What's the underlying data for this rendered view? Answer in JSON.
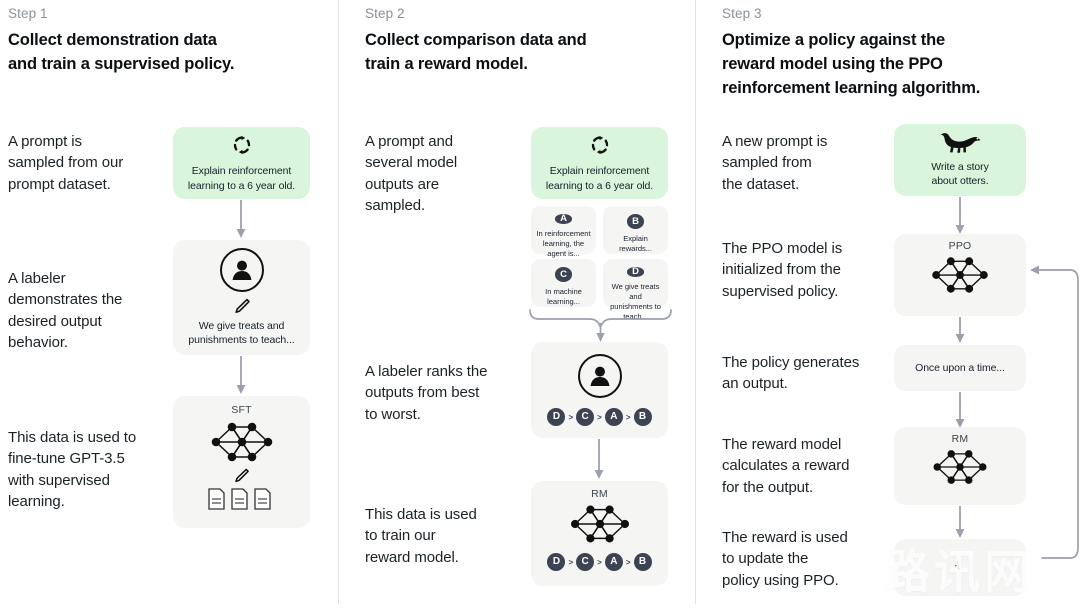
{
  "columns": [
    {
      "step_label": "Step 1",
      "title_line1": "Collect demonstration data",
      "title_line2": "and train a supervised policy.",
      "descriptions": [
        "A prompt is\nsampled from our\nprompt dataset.",
        "A labeler\ndemonstrates the\ndesired output\nbehavior.",
        "This data is used to\nfine-tune GPT-3.5\nwith supervised\nlearning."
      ],
      "cards": [
        {
          "kind": "prompt",
          "icon": "cycle-icon",
          "text": "Explain reinforcement\nlearning to a 6 year old."
        },
        {
          "kind": "labeler",
          "icon": "person-icon",
          "text": "We give treats and\npunishments to teach..."
        },
        {
          "kind": "model",
          "icon": "neural-net-icon",
          "title": "SFT",
          "text": ""
        }
      ]
    },
    {
      "step_label": "Step 2",
      "title_line1": "Collect comparison data and",
      "title_line2": "train a reward model.",
      "descriptions": [
        "A prompt and\nseveral model\noutputs are\nsampled.",
        "A labeler ranks the\noutputs from best\nto worst.",
        "This data is used\nto train our\nreward model."
      ],
      "cards": [
        {
          "kind": "prompt",
          "icon": "cycle-icon",
          "text": "Explain reinforcement\nlearning to a 6 year old."
        },
        {
          "kind": "labeler",
          "icon": "person-icon",
          "text": ""
        },
        {
          "kind": "model",
          "icon": "neural-net-icon",
          "title": "RM",
          "text": ""
        }
      ],
      "options": [
        {
          "badge": "A",
          "text": "In reinforcement\nlearning, the\nagent is..."
        },
        {
          "badge": "B",
          "text": "Explain rewards..."
        },
        {
          "badge": "C",
          "text": "In machine\nlearning..."
        },
        {
          "badge": "D",
          "text": "We give treats and\npunishments to\nteach..."
        }
      ],
      "ranking": [
        "D",
        "C",
        "A",
        "B"
      ],
      "ranking_separator": ">"
    },
    {
      "step_label": "Step 3",
      "title_line1": "Optimize a policy against the",
      "title_line2": "reward model using the PPO",
      "title_line3": "reinforcement learning algorithm.",
      "descriptions": [
        "A new prompt is\nsampled from\nthe dataset.",
        "The PPO model is\ninitialized from the\nsupervised policy.",
        "The policy generates\nan output.",
        "The reward model\ncalculates a reward\nfor the output.",
        "The reward is used\nto update the\npolicy using PPO."
      ],
      "cards": [
        {
          "kind": "prompt",
          "icon": "otter-icon",
          "text": "Write a story\nabout otters."
        },
        {
          "kind": "model",
          "icon": "neural-net-icon",
          "title": "PPO",
          "text": ""
        },
        {
          "kind": "output",
          "icon": "",
          "title": "",
          "text": "Once upon a time..."
        },
        {
          "kind": "model",
          "icon": "neural-net-icon",
          "title": "RM",
          "text": ""
        },
        {
          "kind": "reward",
          "icon": "reward-symbol-icon",
          "title": "",
          "text": ""
        }
      ]
    }
  ],
  "watermark": {
    "text": "路讯网"
  },
  "colors": {
    "green_card": "#d9f5dc",
    "gray_card": "#f5f5f4",
    "badge": "#3c4352",
    "arrow": "#9ca0ae",
    "divider": "#e3e3e3",
    "step_label": "#8a9199",
    "body_text": "#1b2226"
  }
}
